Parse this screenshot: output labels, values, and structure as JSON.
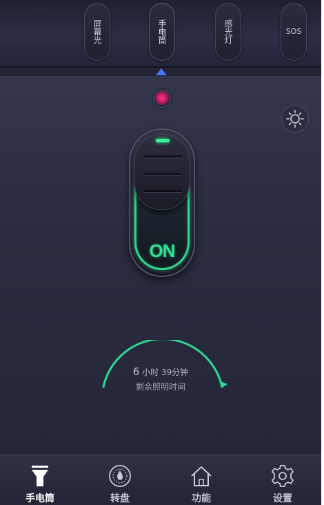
{
  "mode_bar": {
    "modes": [
      {
        "label": "屏幕光"
      },
      {
        "label": "手电筒"
      },
      {
        "label": "感光灯"
      },
      {
        "label": "SOS"
      }
    ],
    "active_index": 1,
    "indicator_color": "#4a74ff"
  },
  "status_led": {
    "icon": "pink-status-led",
    "color": "#ff3a8a"
  },
  "brightness": {
    "icon": "brightness-sun-icon"
  },
  "power_toggle": {
    "state_label": "ON",
    "accent_color": "#2fd88f"
  },
  "remaining": {
    "hours": "6",
    "hours_unit": "小时",
    "minutes_text": "39分钟",
    "caption": "剩余照明时间"
  },
  "tabs": [
    {
      "label": "手电筒",
      "icon": "flashlight-icon",
      "active": true
    },
    {
      "label": "转盘",
      "icon": "dial-icon",
      "active": false
    },
    {
      "label": "功能",
      "icon": "home-icon",
      "active": false
    },
    {
      "label": "设置",
      "icon": "gear-icon",
      "active": false
    }
  ]
}
